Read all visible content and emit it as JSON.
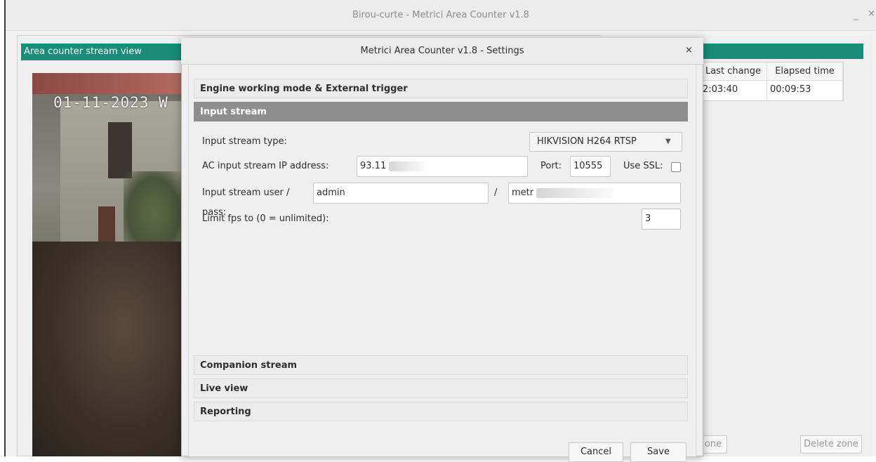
{
  "window": {
    "title": "Birou-curte - Metrici Area Counter v1.8",
    "minimize": "_",
    "close": "×"
  },
  "left_panel": {
    "header": "Area counter stream view",
    "camera_timestamp": "01-11-2023 W"
  },
  "right_panel": {
    "columns": [
      "Last change",
      "Elapsed time"
    ],
    "rows": [
      {
        "last_change": "2:03:40",
        "elapsed": "00:09:53"
      }
    ],
    "add_zone_button": "one",
    "delete_zone_button": "Delete zone"
  },
  "dialog": {
    "title": "Metrici Area Counter v1.8 - Settings",
    "close": "×",
    "sections": {
      "engine": "Engine working mode & External trigger",
      "input_stream": "Input stream",
      "companion": "Companion stream",
      "live_view": "Live view",
      "reporting": "Reporting"
    },
    "input_stream": {
      "type_label": "Input stream type:",
      "type_value": "HIKVISION H264 RTSP",
      "ip_label": "AC input stream IP address:",
      "ip_value": "93.11",
      "port_label": "Port:",
      "port_value": "10555",
      "ssl_label": "Use SSL:",
      "ssl_checked": false,
      "userpass_label": "Input stream user / pass:",
      "user_value": "admin",
      "separator": "/",
      "pass_value": "metr",
      "fps_label": "Limit fps to (0 = unlimited):",
      "fps_value": "3"
    },
    "buttons": {
      "cancel": "Cancel",
      "save": "Save"
    }
  },
  "colors": {
    "accent": "#1a8c7a",
    "active_section": "#8e8e8e"
  }
}
